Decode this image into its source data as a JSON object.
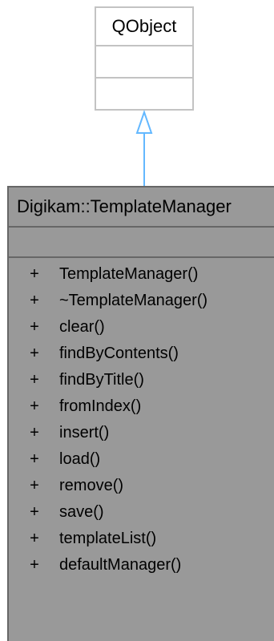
{
  "base_class": {
    "name": "QObject"
  },
  "class": {
    "name": "Digikam::TemplateManager",
    "methods": [
      {
        "visibility": "+",
        "name": "TemplateManager()"
      },
      {
        "visibility": "+",
        "name": "~TemplateManager()"
      },
      {
        "visibility": "+",
        "name": "clear()"
      },
      {
        "visibility": "+",
        "name": "findByContents()"
      },
      {
        "visibility": "+",
        "name": "findByTitle()"
      },
      {
        "visibility": "+",
        "name": "fromIndex()"
      },
      {
        "visibility": "+",
        "name": "insert()"
      },
      {
        "visibility": "+",
        "name": "load()"
      },
      {
        "visibility": "+",
        "name": "remove()"
      },
      {
        "visibility": "+",
        "name": "save()"
      },
      {
        "visibility": "+",
        "name": "templateList()"
      },
      {
        "visibility": "+",
        "name": "defaultManager()"
      }
    ]
  },
  "colors": {
    "arrow": "#63b8ff",
    "base_border": "#c3c3c3",
    "class_fill": "#999999",
    "class_border": "#666666"
  }
}
